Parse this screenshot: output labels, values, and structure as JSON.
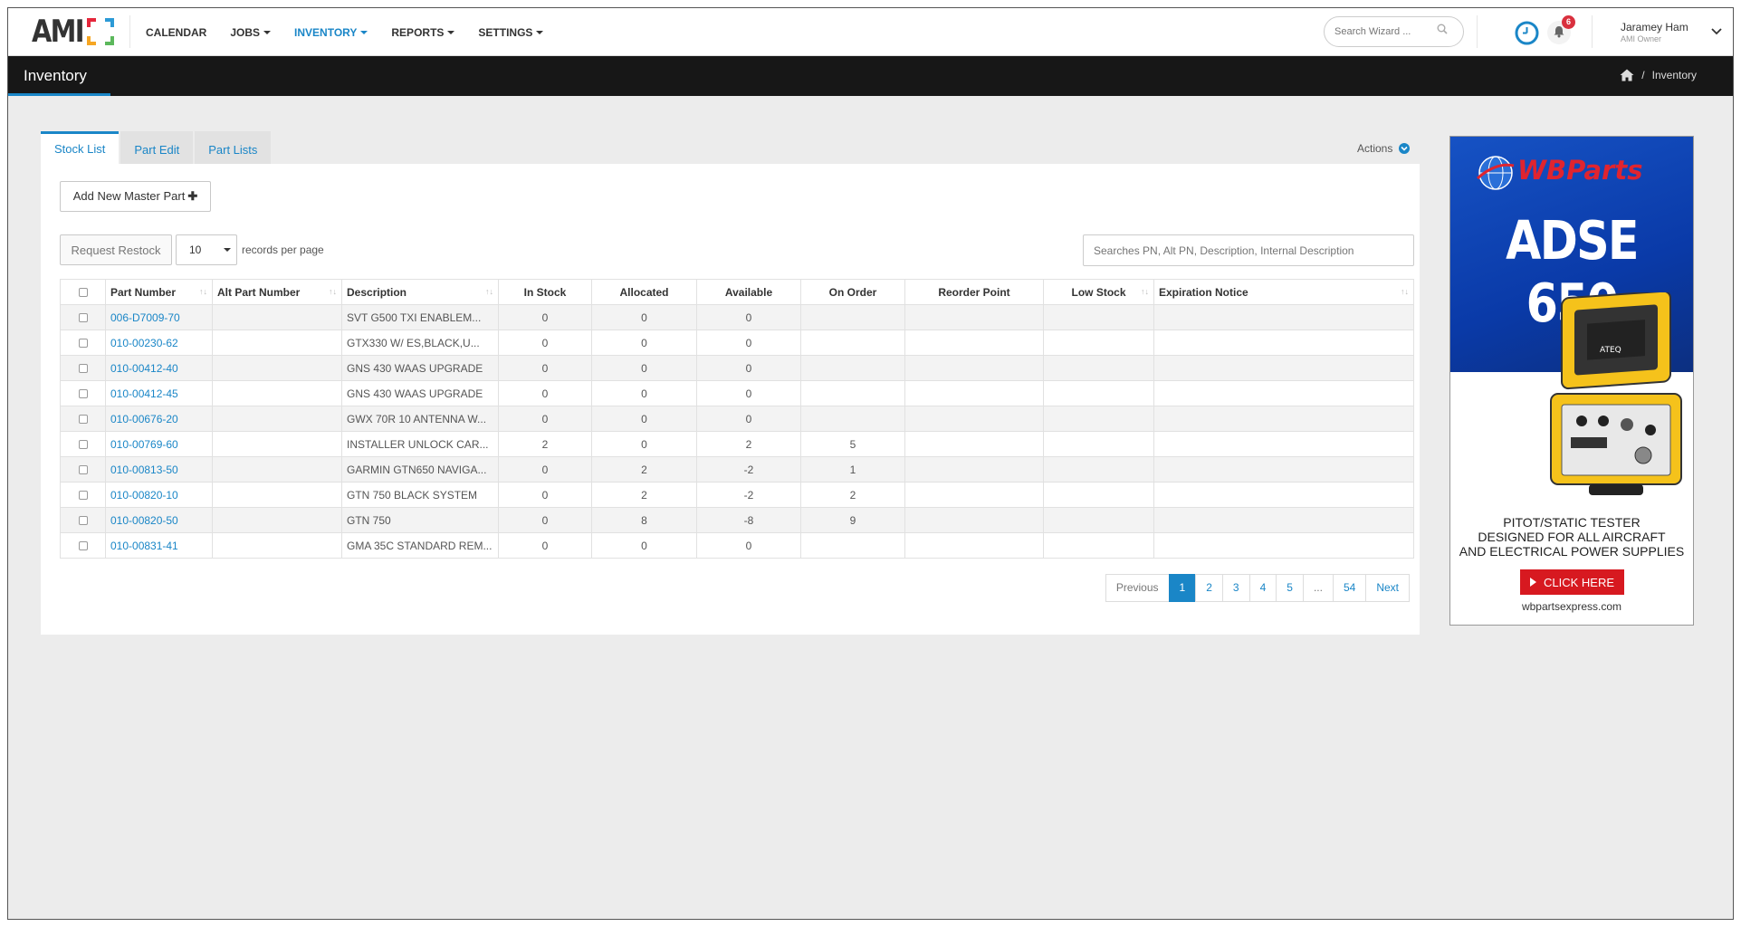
{
  "brand": {
    "logo_text": "AMI",
    "accent": "#1a86c7"
  },
  "nav": {
    "items": [
      {
        "label": "CALENDAR",
        "dropdown": false,
        "active": false
      },
      {
        "label": "JOBS",
        "dropdown": true,
        "active": false
      },
      {
        "label": "INVENTORY",
        "dropdown": true,
        "active": true
      },
      {
        "label": "REPORTS",
        "dropdown": true,
        "active": false
      },
      {
        "label": "SETTINGS",
        "dropdown": true,
        "active": false
      }
    ],
    "search_placeholder": "Search Wizard ...",
    "notification_count": "6",
    "user": {
      "name": "Jaramey Ham",
      "role": "AMI Owner"
    }
  },
  "page": {
    "title": "Inventory",
    "breadcrumb": "Inventory"
  },
  "tabs": [
    {
      "label": "Stock List",
      "active": true
    },
    {
      "label": "Part Edit",
      "active": false
    },
    {
      "label": "Part Lists",
      "active": false
    }
  ],
  "actions_label": "Actions",
  "toolbar": {
    "add_label": "Add New Master Part",
    "restock_label": "Request Restock",
    "per_page_value": "10",
    "per_page_label": "records per page",
    "search_placeholder": "Searches PN, Alt PN, Description, Internal Description"
  },
  "table": {
    "columns": [
      "Part Number",
      "Alt Part Number",
      "Description",
      "In Stock",
      "Allocated",
      "Available",
      "On Order",
      "Reorder Point",
      "Low Stock",
      "Expiration Notice"
    ],
    "rows": [
      {
        "part_number": "006-D7009-70",
        "alt": "",
        "description": "SVT G500 TXI ENABLEM...",
        "in_stock": "0",
        "allocated": "0",
        "available": "0",
        "on_order": "",
        "reorder": "",
        "low": "",
        "exp": ""
      },
      {
        "part_number": "010-00230-62",
        "alt": "",
        "description": "GTX330 W/ ES,BLACK,U...",
        "in_stock": "0",
        "allocated": "0",
        "available": "0",
        "on_order": "",
        "reorder": "",
        "low": "",
        "exp": ""
      },
      {
        "part_number": "010-00412-40",
        "alt": "",
        "description": "GNS 430 WAAS UPGRADE",
        "in_stock": "0",
        "allocated": "0",
        "available": "0",
        "on_order": "",
        "reorder": "",
        "low": "",
        "exp": ""
      },
      {
        "part_number": "010-00412-45",
        "alt": "",
        "description": "GNS 430 WAAS UPGRADE",
        "in_stock": "0",
        "allocated": "0",
        "available": "0",
        "on_order": "",
        "reorder": "",
        "low": "",
        "exp": ""
      },
      {
        "part_number": "010-00676-20",
        "alt": "",
        "description": "GWX 70R 10 ANTENNA W...",
        "in_stock": "0",
        "allocated": "0",
        "available": "0",
        "on_order": "",
        "reorder": "",
        "low": "",
        "exp": ""
      },
      {
        "part_number": "010-00769-60",
        "alt": "",
        "description": "INSTALLER UNLOCK CAR...",
        "in_stock": "2",
        "allocated": "0",
        "available": "2",
        "on_order": "5",
        "reorder": "",
        "low": "",
        "exp": ""
      },
      {
        "part_number": "010-00813-50",
        "alt": "",
        "description": "GARMIN GTN650 NAVIGA...",
        "in_stock": "0",
        "allocated": "2",
        "available": "-2",
        "on_order": "1",
        "reorder": "",
        "low": "",
        "exp": ""
      },
      {
        "part_number": "010-00820-10",
        "alt": "",
        "description": "GTN 750 BLACK SYSTEM",
        "in_stock": "0",
        "allocated": "2",
        "available": "-2",
        "on_order": "2",
        "reorder": "",
        "low": "",
        "exp": ""
      },
      {
        "part_number": "010-00820-50",
        "alt": "",
        "description": "GTN 750",
        "in_stock": "0",
        "allocated": "8",
        "available": "-8",
        "on_order": "9",
        "reorder": "",
        "low": "",
        "exp": ""
      },
      {
        "part_number": "010-00831-41",
        "alt": "",
        "description": "GMA 35C STANDARD REM...",
        "in_stock": "0",
        "allocated": "0",
        "available": "0",
        "on_order": "",
        "reorder": "",
        "low": "",
        "exp": ""
      }
    ]
  },
  "pagination": {
    "previous": "Previous",
    "pages": [
      "1",
      "2",
      "3",
      "4",
      "5",
      "...",
      "54"
    ],
    "current": "1",
    "next": "Next"
  },
  "ad": {
    "brand": "WBParts",
    "model": "ADSE 650",
    "tagline_1": "PITOT/STATIC TESTER",
    "tagline_2": "DESIGNED FOR ALL AIRCRAFT",
    "tagline_3": "AND ELECTRICAL POWER SUPPLIES",
    "cta": "CLICK HERE",
    "url": "wbpartsexpress.com",
    "device_label": "ATEQ"
  }
}
